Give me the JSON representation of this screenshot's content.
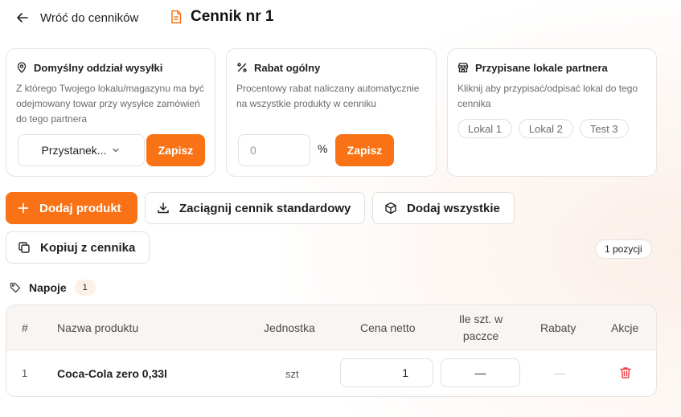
{
  "header": {
    "back_label": "Wróć do cenników",
    "title": "Cennik nr 1"
  },
  "cards": {
    "branch": {
      "title": "Domyślny oddział wysyłki",
      "description": "Z którego Twojego lokalu/magazynu ma być odejmowany towar przy wysyłce zamówień do tego partnera",
      "selected": "Przystanek...",
      "save_label": "Zapisz"
    },
    "discount": {
      "title": "Rabat ogólny",
      "description": "Procentowy rabat naliczany automatycznie na wszystkie produkty w cenniku",
      "placeholder": "0",
      "unit": "%",
      "save_label": "Zapisz"
    },
    "locations": {
      "title": "Przypisane lokale partnera",
      "description": "Kliknij aby przypisać/odpisać lokal do tego cennika",
      "chips": [
        "Lokal 1",
        "Lokal 2",
        "Test 3"
      ]
    }
  },
  "actions": {
    "add_product": "Dodaj produkt",
    "pull_standard": "Zaciągnij cennik standardowy",
    "add_all": "Dodaj wszystkie",
    "copy_from": "Kopiuj z cennika"
  },
  "positions_count": "1 pozycji",
  "group": {
    "name": "Napoje",
    "count": "1"
  },
  "table": {
    "headers": {
      "num": "#",
      "name": "Nazwa produktu",
      "unit": "Jednostka",
      "price": "Cena netto",
      "per_pack_1": "Ile szt. w",
      "per_pack_2": "paczce",
      "discounts": "Rabaty",
      "actions": "Akcje"
    },
    "rows": [
      {
        "num": "1",
        "name": "Coca-Cola zero 0,33l",
        "unit": "szt",
        "price": "1",
        "per_pack": "—",
        "discounts": "—"
      }
    ]
  },
  "colors": {
    "accent": "#f97316",
    "danger": "#ef4444"
  }
}
